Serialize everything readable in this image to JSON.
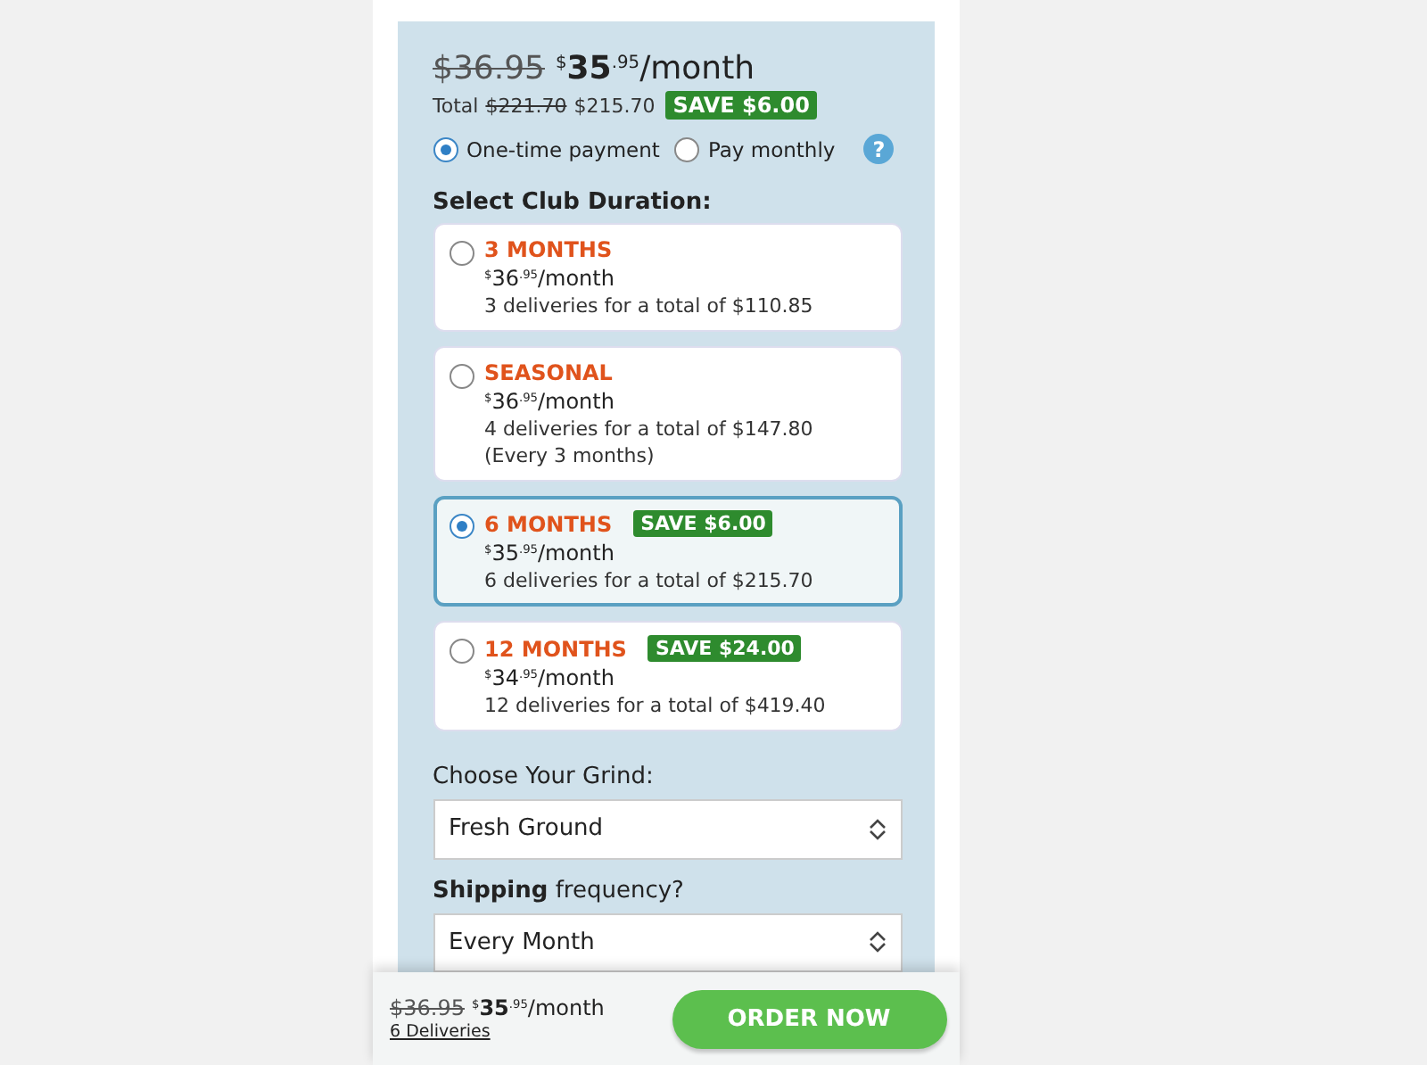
{
  "summary": {
    "old_price": "$36.95",
    "price": {
      "currency": "$",
      "whole": "35",
      "cents": ".95",
      "unit": "/month"
    },
    "total_label": "Total",
    "total_old": "$221.70",
    "total_new": "$215.70",
    "save_badge": "SAVE $6.00"
  },
  "payment_options": [
    {
      "label": "One-time payment",
      "selected": true
    },
    {
      "label": "Pay monthly",
      "selected": false
    }
  ],
  "help": {
    "label": "?"
  },
  "duration": {
    "heading": "Select Club Duration:",
    "options": [
      {
        "title": "3 MONTHS",
        "price": {
          "currency": "$",
          "whole": "36",
          "cents": ".95",
          "unit": "/month"
        },
        "details": [
          "3 deliveries for a total of $110.85"
        ],
        "selected": false
      },
      {
        "title": "SEASONAL",
        "price": {
          "currency": "$",
          "whole": "36",
          "cents": ".95",
          "unit": "/month"
        },
        "details": [
          "4 deliveries for a total of $147.80",
          "(Every 3 months)"
        ],
        "selected": false
      },
      {
        "title": "6 MONTHS",
        "badge": "SAVE $6.00",
        "price": {
          "currency": "$",
          "whole": "35",
          "cents": ".95",
          "unit": "/month"
        },
        "details": [
          "6 deliveries for a total of $215.70"
        ],
        "selected": true
      },
      {
        "title": "12 MONTHS",
        "badge": "SAVE $24.00",
        "price": {
          "currency": "$",
          "whole": "34",
          "cents": ".95",
          "unit": "/month"
        },
        "details": [
          "12 deliveries for a total of $419.40"
        ],
        "selected": false
      }
    ]
  },
  "grind": {
    "label": "Choose Your Grind:",
    "value": "Fresh Ground"
  },
  "shipping": {
    "label": "**Shipping** frequency?",
    "value": "Every Month"
  },
  "footer": {
    "old_price": "$36.95",
    "price": {
      "currency": "$",
      "whole": "35",
      "cents": ".95",
      "unit": "/month"
    },
    "deliveries_link": "6 Deliveries",
    "order_button": "ORDER NOW"
  }
}
